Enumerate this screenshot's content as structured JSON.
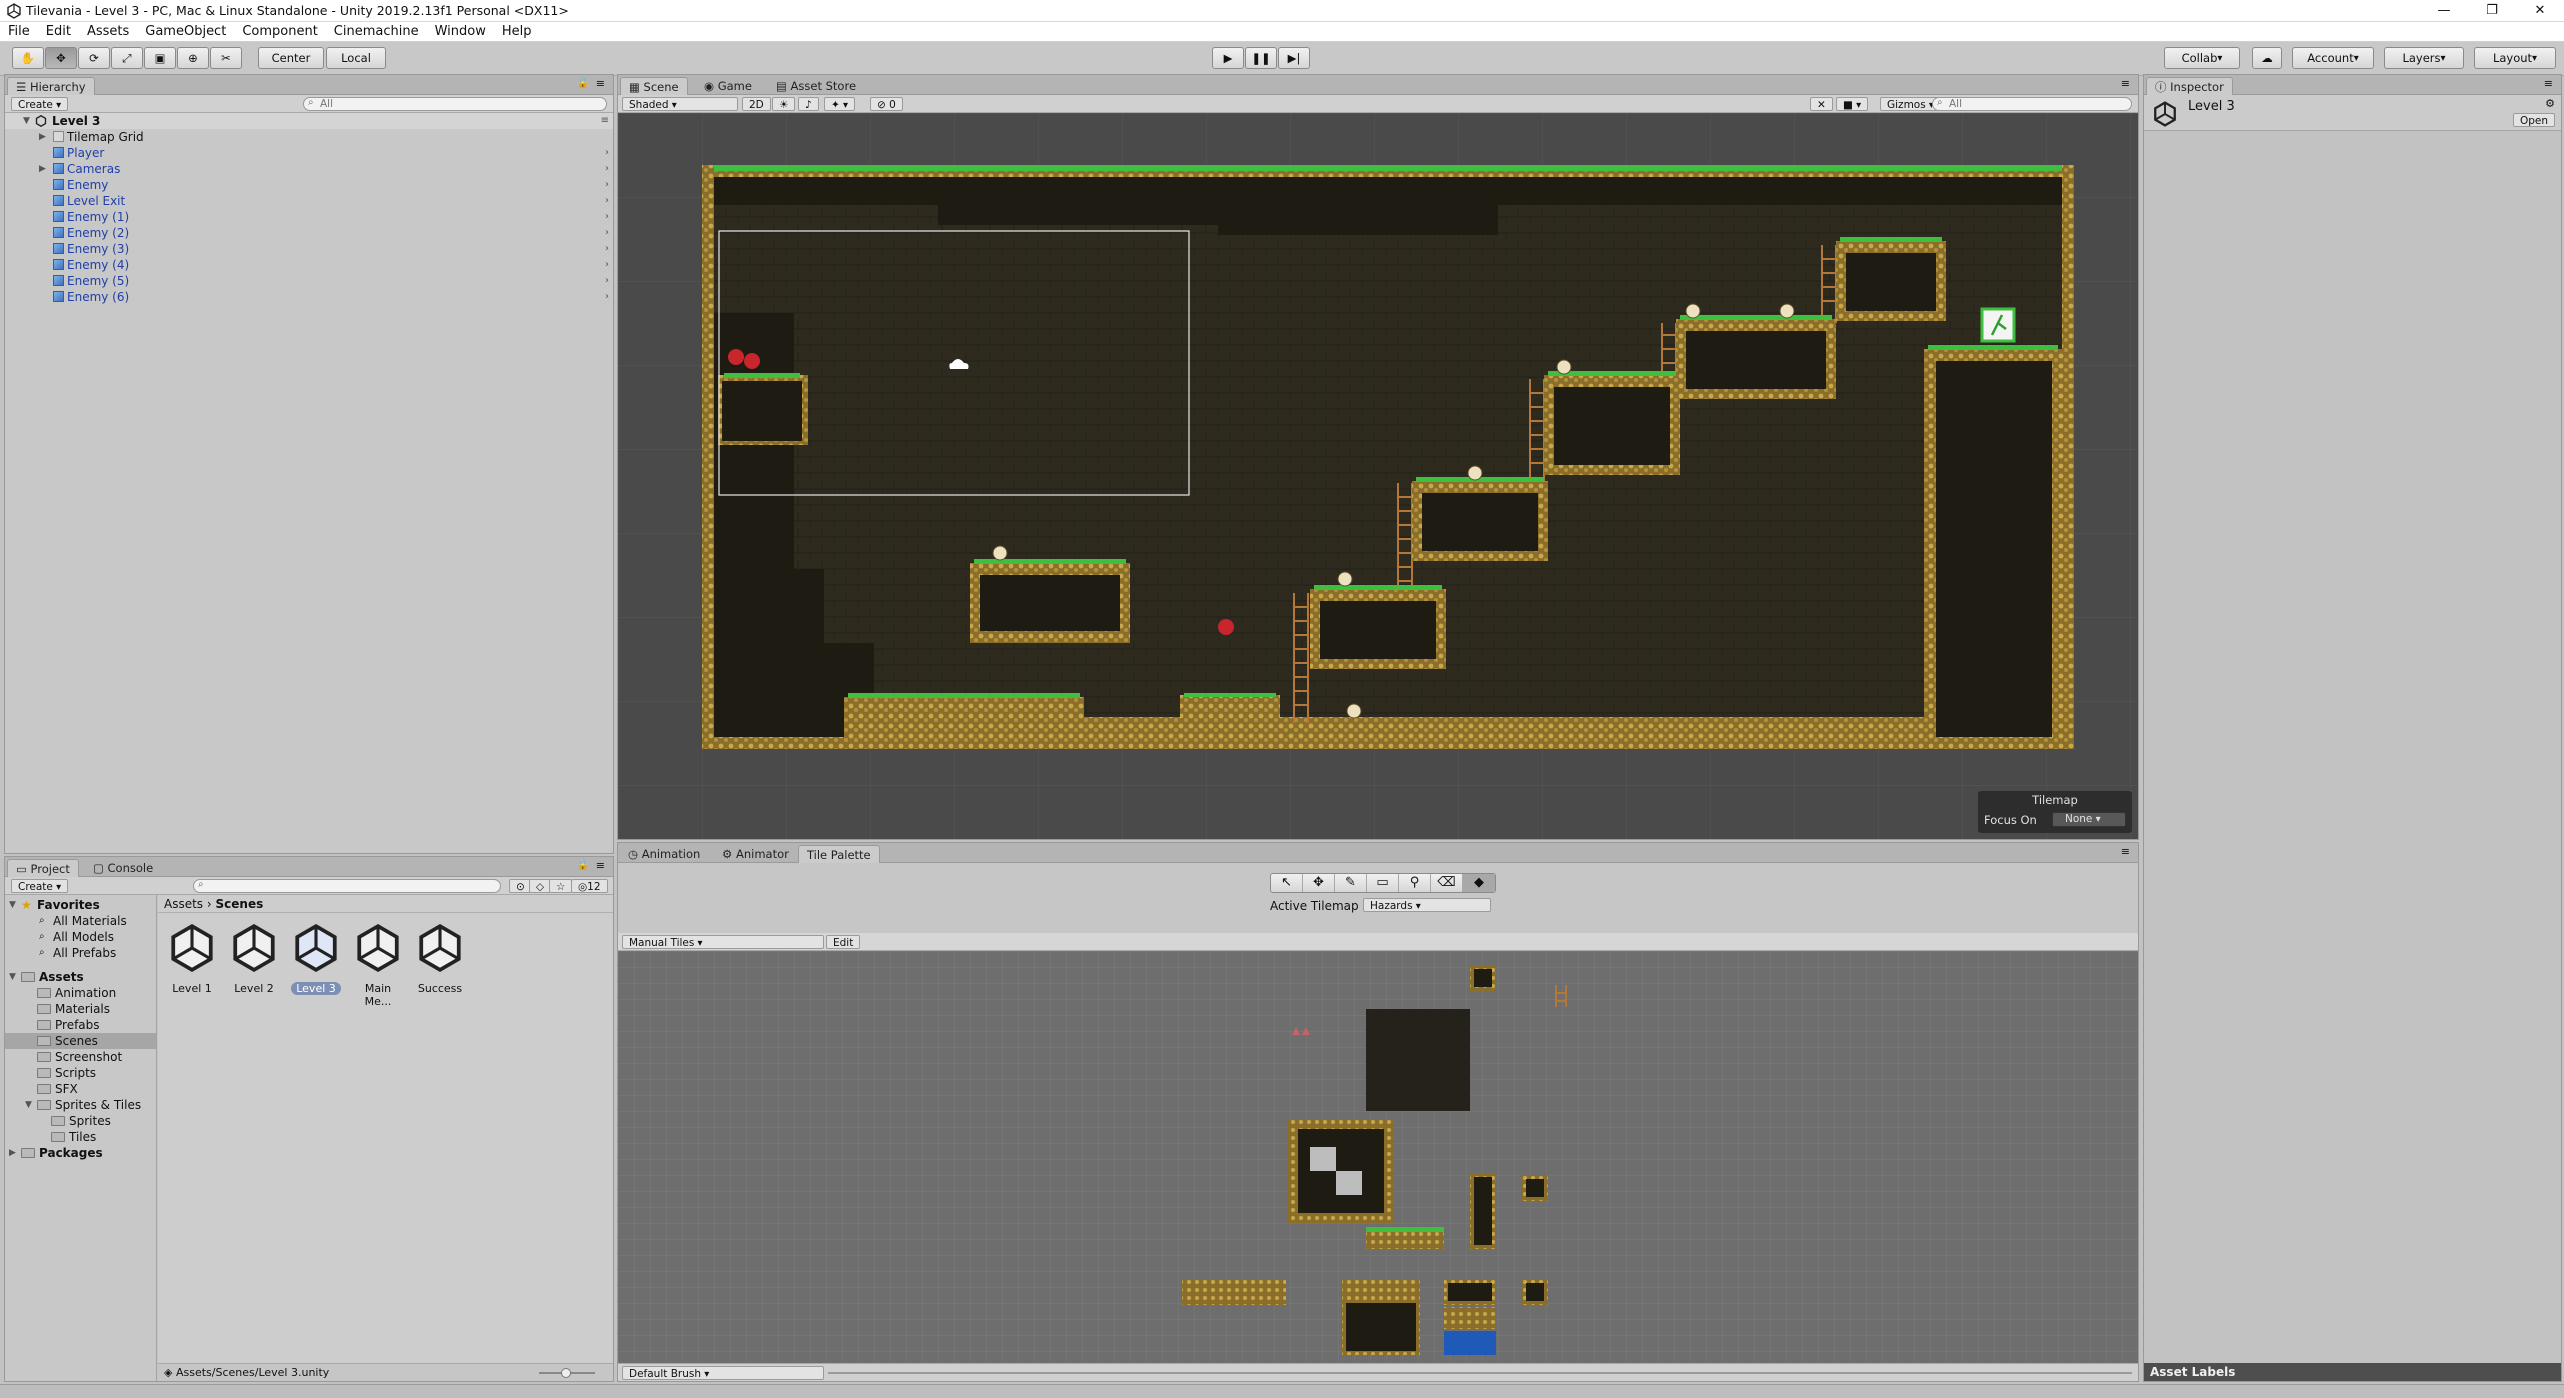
{
  "window": {
    "title": "Tilevania - Level 3 - PC, Mac & Linux Standalone - Unity 2019.2.13f1 Personal <DX11>"
  },
  "menu": [
    "File",
    "Edit",
    "Assets",
    "GameObject",
    "Component",
    "Cinemachine",
    "Window",
    "Help"
  ],
  "toolbar": {
    "pivot_label": "Center",
    "space_label": "Local",
    "collab_label": "Collab",
    "account_label": "Account",
    "layers_label": "Layers",
    "layout_label": "Layout"
  },
  "hierarchy": {
    "tab": "Hierarchy",
    "create_label": "Create",
    "search_placeholder": "All",
    "scene_name": "Level 3",
    "items": [
      {
        "label": "Tilemap Grid",
        "blue": false,
        "expandable": true
      },
      {
        "label": "Player",
        "blue": true,
        "expandable": false
      },
      {
        "label": "Cameras",
        "blue": true,
        "expandable": true
      },
      {
        "label": "Enemy",
        "blue": true,
        "expandable": false
      },
      {
        "label": "Level Exit",
        "blue": true,
        "expandable": false
      },
      {
        "label": "Enemy (1)",
        "blue": true,
        "expandable": false
      },
      {
        "label": "Enemy (2)",
        "blue": true,
        "expandable": false
      },
      {
        "label": "Enemy (3)",
        "blue": true,
        "expandable": false
      },
      {
        "label": "Enemy (4)",
        "blue": true,
        "expandable": false
      },
      {
        "label": "Enemy (5)",
        "blue": true,
        "expandable": false
      },
      {
        "label": "Enemy (6)",
        "blue": true,
        "expandable": false
      }
    ]
  },
  "scene_view": {
    "tabs": [
      "Scene",
      "Game",
      "Asset Store"
    ],
    "shading": "Shaded",
    "mode_2d": "2D",
    "hidden_count": "0",
    "gizmos_label": "Gizmos",
    "search_placeholder": "All",
    "overlay_title": "Tilemap",
    "focus_label": "Focus On",
    "focus_value": "None"
  },
  "inspector": {
    "tab": "Inspector",
    "object_name": "Level 3",
    "open_button": "Open",
    "asset_labels": "Asset Labels"
  },
  "project": {
    "tabs": [
      "Project",
      "Console"
    ],
    "create_label": "Create",
    "badge_count": "12",
    "favorites_label": "Favorites",
    "favorites": [
      "All Materials",
      "All Models",
      "All Prefabs"
    ],
    "assets_label": "Assets",
    "asset_folders": [
      "Animation",
      "Materials",
      "Prefabs",
      "Scenes",
      "Screenshot",
      "Scripts",
      "SFX",
      "Sprites & Tiles",
      "Sprites",
      "Tiles"
    ],
    "packages_label": "Packages",
    "breadcrumb": [
      "Assets",
      "Scenes"
    ],
    "scenes": [
      "Level 1",
      "Level 2",
      "Level 3",
      "Main Me...",
      "Success"
    ],
    "selected_scene": "Level 3",
    "footer_path": "Assets/Scenes/Level 3.unity"
  },
  "bottom_panel": {
    "tabs": [
      "Animation",
      "Animator",
      "Tile Palette"
    ],
    "active_tilemap_label": "Active Tilemap",
    "active_tilemap_value": "Hazards",
    "palette_name": "Manual Tiles",
    "edit_label": "Edit",
    "brush_label": "Default Brush"
  },
  "colors": {
    "grass": "#3fbf3f",
    "rock": "#2b2818",
    "rock_edge": "#c9a84a",
    "selection": "#7d8fb5"
  }
}
